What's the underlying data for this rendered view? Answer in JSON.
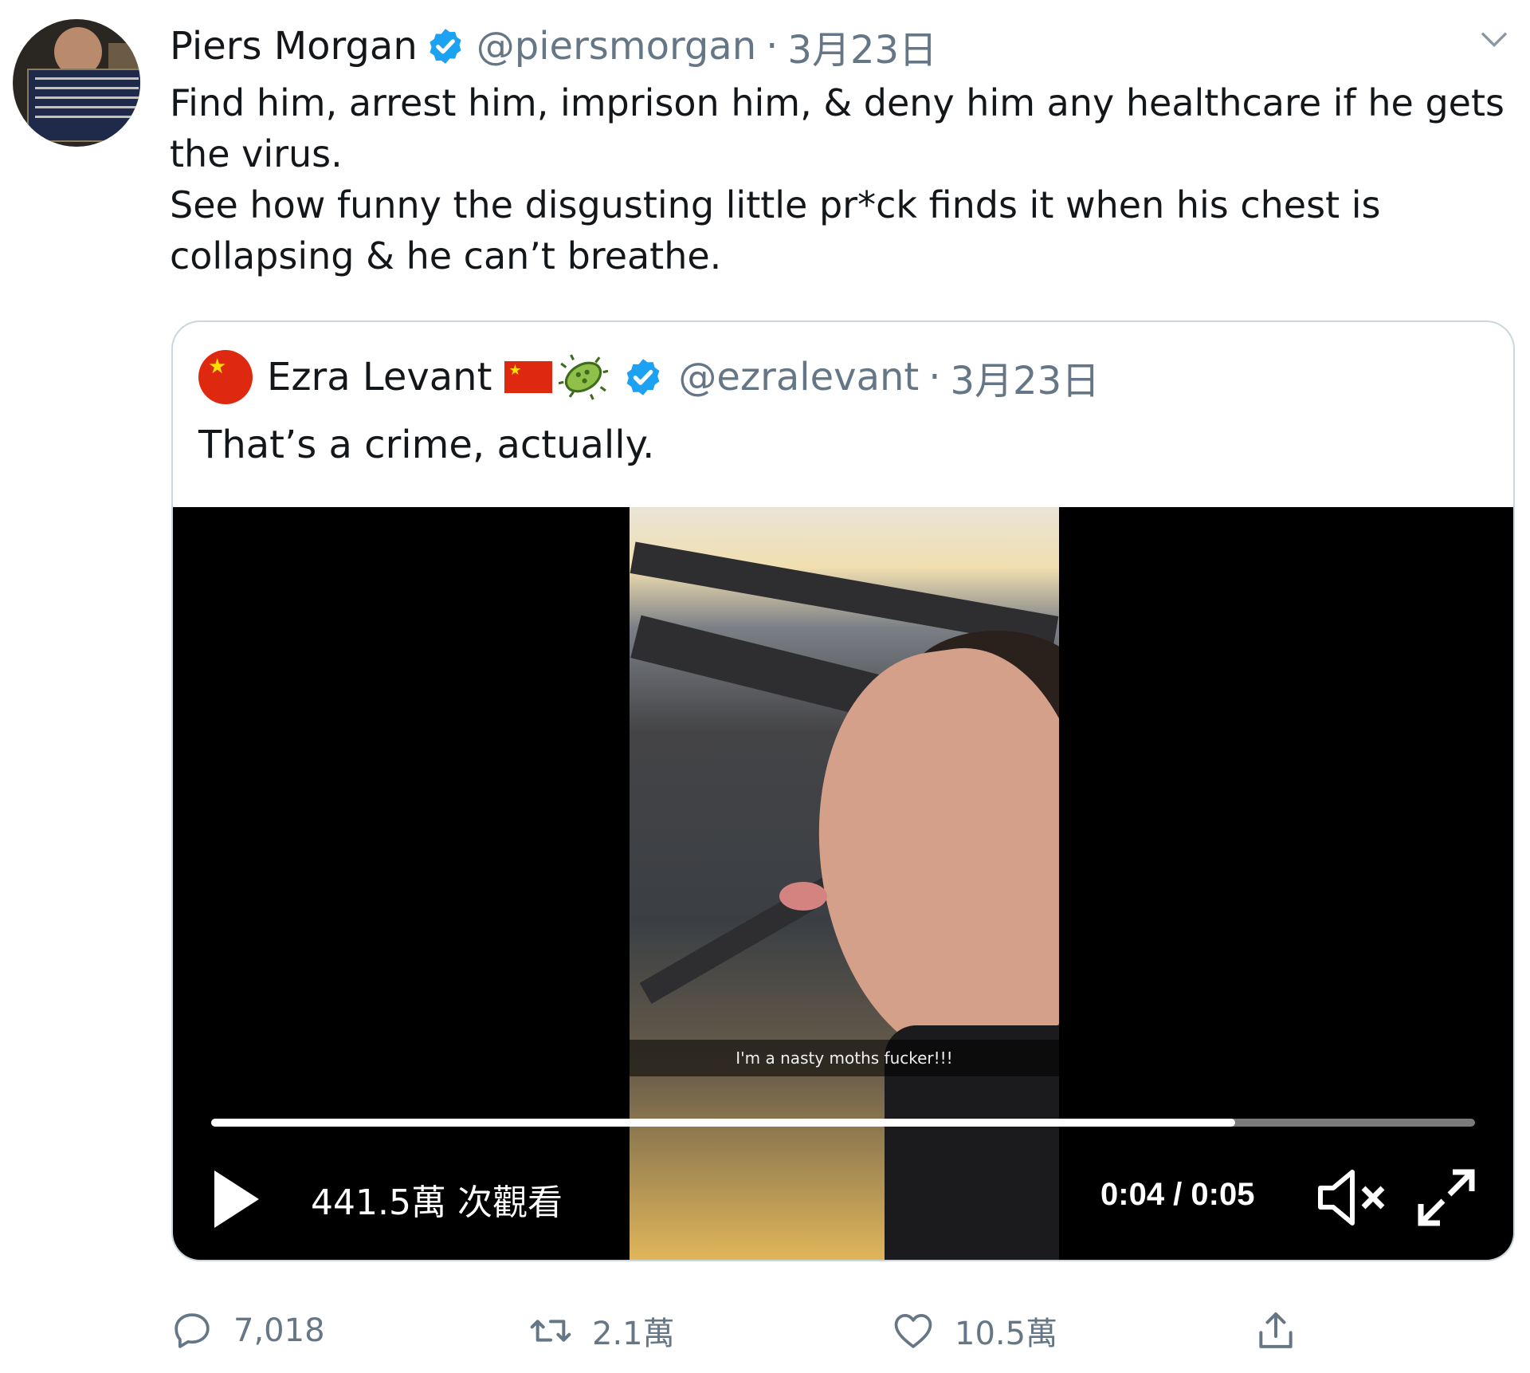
{
  "tweet": {
    "author_name": "Piers Morgan",
    "handle": "@piersmorgan",
    "separator": "·",
    "date": "3月23日",
    "avatar_icon": "avatar",
    "text": "Find him, arrest him, imprison him, & deny him any healthcare if he gets\nthe virus.\nSee how funny the disgusting little pr*ck finds it when his chest is\ncollapsing & he can’t breathe."
  },
  "quoted": {
    "author_name": "Ezra Levant",
    "handle": "@ezralevant",
    "separator": "·",
    "date": "3月23日",
    "emoji": [
      "flag-china-icon",
      "microbe-icon"
    ],
    "text": "That’s a crime, actually.",
    "video": {
      "caption": "I'm a nasty moths fucker!!!",
      "views": "441.5萬 次觀看",
      "time": "0:04 / 0:05",
      "progress": 0.81
    }
  },
  "actions": {
    "reply_count": "7,018",
    "retweet_count": "2.1萬",
    "like_count": "10.5萬"
  },
  "colors": {
    "verified": "#1da1f2",
    "secondary_text": "#657786",
    "border": "#ccd6dd"
  }
}
